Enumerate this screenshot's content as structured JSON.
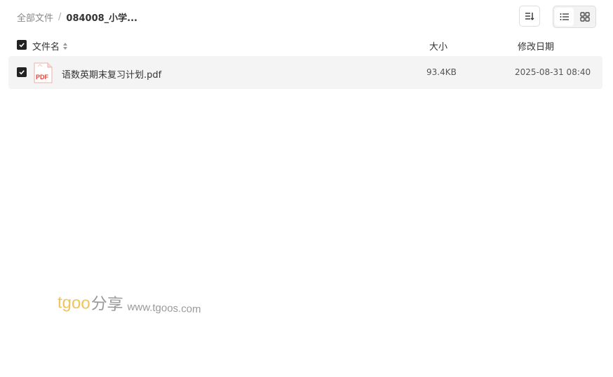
{
  "breadcrumb": {
    "root": "全部文件",
    "separator": "/",
    "current": "084008_小学..."
  },
  "toolbar": {
    "sort_icon": "sort-icon",
    "list_view_icon": "list-view-icon",
    "grid_view_icon": "grid-view-icon",
    "active_view": "list"
  },
  "table": {
    "headers": {
      "name": "文件名",
      "size": "大小",
      "date": "修改日期"
    },
    "header_checked": true,
    "rows": [
      {
        "checked": true,
        "icon": "pdf-icon",
        "icon_label": "PDF",
        "name": "语数英期末复习计划.pdf",
        "size": "93.4KB",
        "date": "2025-08-31 08:40"
      }
    ]
  },
  "watermark": {
    "brand": "tgoo",
    "share": "分享",
    "url": "www.tgoos.com"
  },
  "colors": {
    "row_bg": "#f4f4f4",
    "checkbox": "#222222",
    "pdf_red": "#e0453a",
    "watermark_brand": "#f0c45a",
    "watermark_text": "#9a9a9a"
  }
}
